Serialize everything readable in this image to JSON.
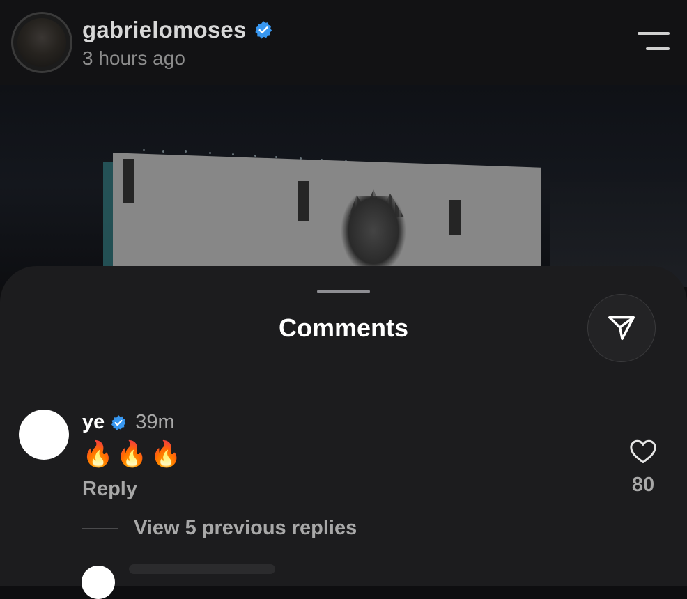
{
  "post": {
    "username": "gabrielomoses",
    "verified": true,
    "timestamp": "3 hours ago"
  },
  "comments_sheet": {
    "title": "Comments",
    "share_icon": "paper-plane-icon",
    "comments": [
      {
        "username": "ye",
        "verified": true,
        "time": "39m",
        "text": "🔥🔥🔥",
        "reply_label": "Reply",
        "like_count": "80",
        "view_replies_label": "View 5 previous replies"
      }
    ]
  },
  "colors": {
    "verified_badge": "#3897f0",
    "background": "#0e0e10",
    "sheet": "#1c1c1e",
    "secondary_text": "#a8a8a8"
  }
}
